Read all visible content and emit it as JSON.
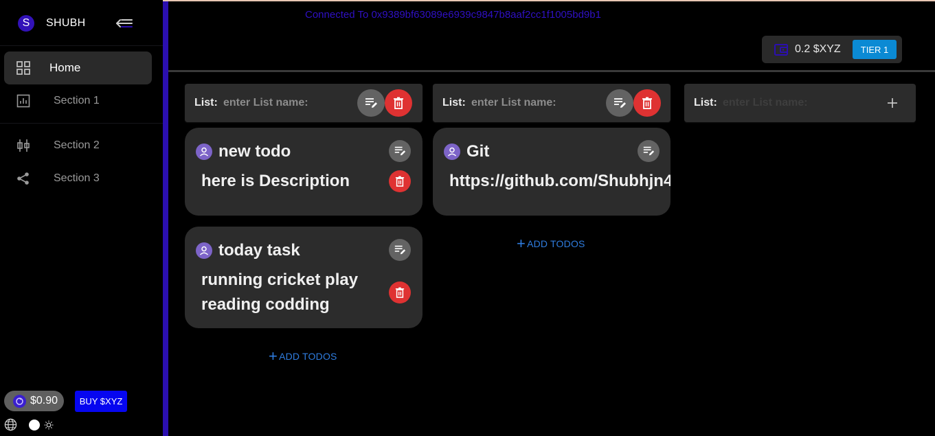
{
  "app": {
    "brand_initial": "S",
    "brand_name": "SHUBH"
  },
  "sidebar": {
    "items": [
      {
        "label": "Home",
        "icon": "grid-icon",
        "active": true
      },
      {
        "label": "Section 1",
        "icon": "chart-icon"
      },
      {
        "label": "Section 2",
        "icon": "sliders-icon"
      },
      {
        "label": "Section 3",
        "icon": "share-icon"
      }
    ],
    "price": "$0.90",
    "buy_label": "BUY $XYZ"
  },
  "header": {
    "connected_text": "Connected To 0x9389bf63089e6939c9847b8aaf2cc1f1005bd9b1",
    "wallet_balance": "0.2 $XYZ",
    "tier_label": "TIER 1"
  },
  "lists": [
    {
      "label": "List:",
      "placeholder": "enter List name:",
      "todos": [
        {
          "title": "new todo",
          "description": "here is Description"
        },
        {
          "title": "today task",
          "description_lines": [
            "running cricket play",
            "reading codding"
          ]
        }
      ],
      "add_label": "ADD TODOS"
    },
    {
      "label": "List:",
      "placeholder": "enter List name:",
      "todos": [
        {
          "title": "Git",
          "description": "https://github.com/Shubhjn4"
        }
      ],
      "add_label": "ADD TODOS"
    },
    {
      "label": "List:",
      "placeholder": "enter List name:"
    }
  ],
  "colors": {
    "accent": "#2b0fb0",
    "danger": "#df3232",
    "link": "#2f7de0",
    "tier": "#0b8ad4",
    "buy": "#0606f0"
  }
}
